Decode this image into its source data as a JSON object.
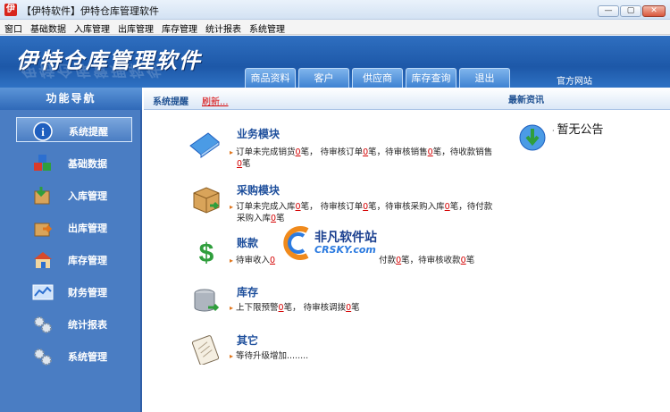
{
  "window": {
    "title": "【伊特软件】伊特仓库管理软件",
    "icon_char": "伊",
    "buttons": {
      "minimize": "—",
      "restore": "▢",
      "close": "✕"
    }
  },
  "menu": [
    "窗口",
    "基础数据",
    "入库管理",
    "出库管理",
    "库存管理",
    "统计报表",
    "系统管理"
  ],
  "banner": {
    "title": "伊特仓库管理软件",
    "tabs": [
      "商品资料",
      "客户",
      "供应商",
      "库存查询",
      "退出"
    ],
    "official_site": "官方网站"
  },
  "sidebar": {
    "heading": "功能导航",
    "items": [
      {
        "label": "系统提醒",
        "icon": "info-icon",
        "active": true
      },
      {
        "label": "基础数据",
        "icon": "cubes-icon"
      },
      {
        "label": "入库管理",
        "icon": "box-in-icon"
      },
      {
        "label": "出库管理",
        "icon": "box-out-icon"
      },
      {
        "label": "库存管理",
        "icon": "warehouse-icon"
      },
      {
        "label": "财务管理",
        "icon": "chart-icon"
      },
      {
        "label": "统计报表",
        "icon": "gears-icon"
      },
      {
        "label": "系统管理",
        "icon": "gears-icon"
      }
    ]
  },
  "content_header": {
    "remind": "系统提醒",
    "refresh": "刷新...",
    "news": "最新资讯"
  },
  "modules": {
    "business": {
      "title": "业务模块",
      "line1": [
        "订单未完成销货",
        "0",
        "笔， 待审核订单",
        "0",
        "笔，待审核销售",
        "0",
        "笔，待收款销售"
      ],
      "line2": [
        "0",
        "笔"
      ]
    },
    "purchase": {
      "title": "采购模块",
      "line1": [
        "订单未完成入库",
        "0",
        "笔， 待审核订单",
        "0",
        "笔，待审核采购入库",
        "0",
        "笔，待付款"
      ],
      "line2": [
        "采购入库",
        "0",
        "笔"
      ]
    },
    "account": {
      "title": "账款",
      "line1": [
        "待审收入",
        "0",
        "付款",
        "0",
        "笔，待审核收款",
        "0",
        "笔"
      ]
    },
    "stock": {
      "title": "库存",
      "line1": [
        "上下限预警",
        "0",
        "笔， 待审核调拨",
        "0",
        "笔"
      ]
    },
    "other": {
      "title": "其它",
      "line1": "等待升级增加........"
    }
  },
  "notice": "暂无公告",
  "watermark": {
    "text": "非凡软件站",
    "sub": "CRSKY.com"
  }
}
